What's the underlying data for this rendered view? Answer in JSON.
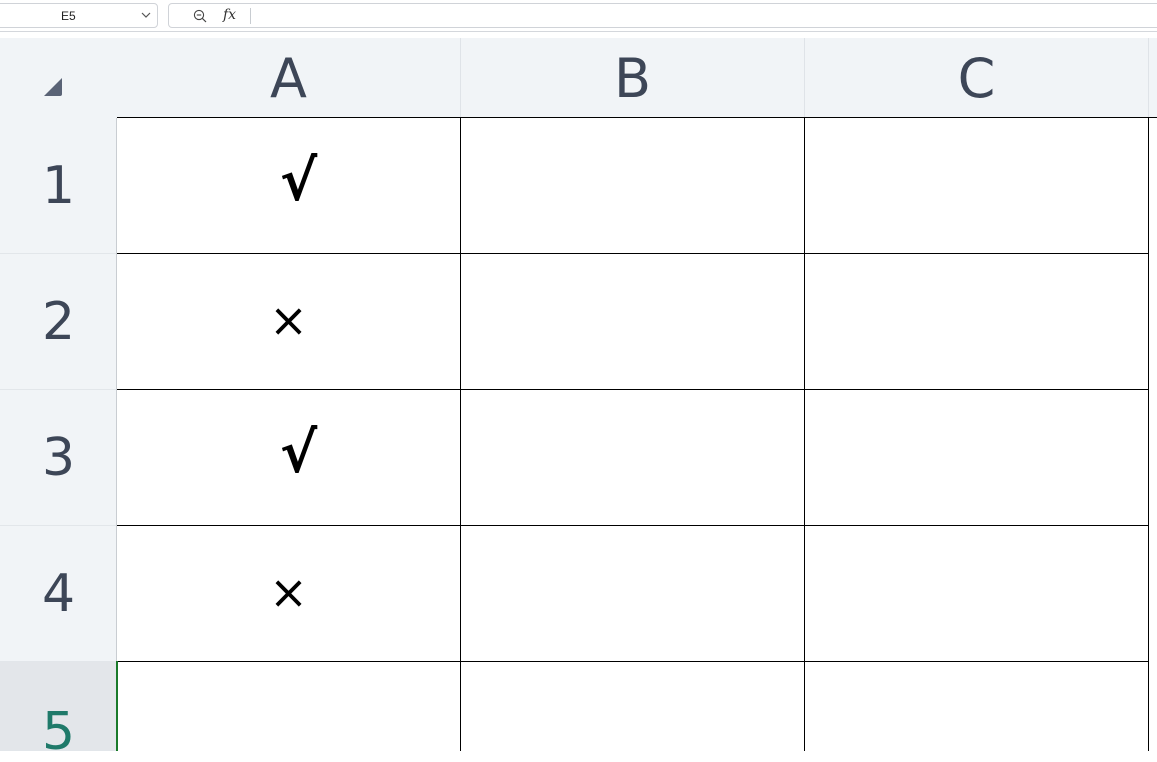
{
  "name_box": {
    "value": "E5"
  },
  "formula_bar": {
    "fx_label": "fx",
    "value": ""
  },
  "columns": [
    "A",
    "B",
    "C"
  ],
  "rows": [
    {
      "label": "1",
      "cells": [
        "√",
        "",
        ""
      ]
    },
    {
      "label": "2",
      "cells": [
        "×",
        "",
        ""
      ]
    },
    {
      "label": "3",
      "cells": [
        "√",
        "",
        ""
      ]
    },
    {
      "label": "4",
      "cells": [
        "×",
        "",
        ""
      ]
    },
    {
      "label": "5",
      "cells": [
        "",
        "",
        ""
      ],
      "active": true
    }
  ],
  "icons": {
    "name_box_dropdown": "chevron-down-icon",
    "zoom": "zoom-out-icon",
    "select_all": "select-all-triangle-icon"
  },
  "colors": {
    "header_bg": "#f1f4f7",
    "header_text": "#3d4657",
    "active_row_text": "#1f7a6a",
    "active_cell_border": "#1a7a2a"
  }
}
